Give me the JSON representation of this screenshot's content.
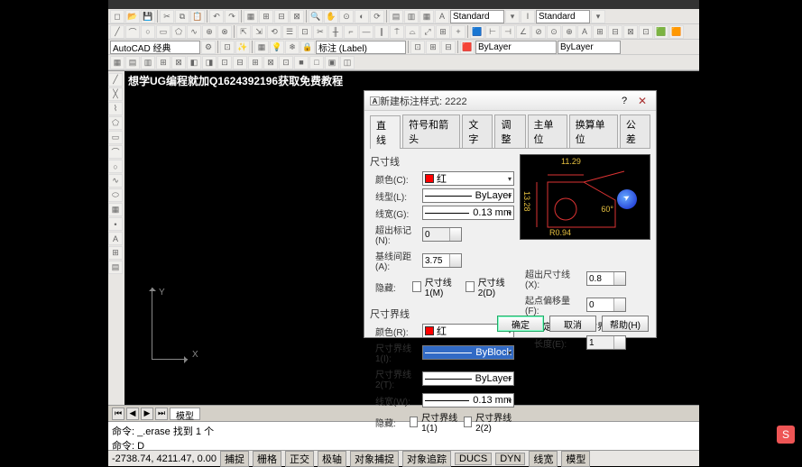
{
  "app": {
    "watermark": "想学UG编程就加Q1624392196获取免费教程",
    "toolbar": {
      "workspace_combo": "AutoCAD 经典",
      "annotation_combo": "标注 (Label)",
      "layer_combo": "ByLayer",
      "layer_combo2": "ByLayer",
      "std_combo1": "Standard",
      "std_combo2": "Standard"
    },
    "axis": {
      "x": "X",
      "y": "Y"
    },
    "bottom_tabs": {
      "model": "模型"
    },
    "cmd": {
      "line1": "命令: _.erase 找到 1 个",
      "line2": "命令: D"
    },
    "status": {
      "coords": "-2738.74, 4211.47, 0.00",
      "btns": [
        "捕捉",
        "栅格",
        "正交",
        "极轴",
        "对象捕捉",
        "对象追踪",
        "DUCS",
        "DYN",
        "线宽",
        "模型"
      ]
    }
  },
  "dialog": {
    "title": "新建标注样式: 2222",
    "help_btn": "?",
    "close_btn": "✕",
    "tabs": [
      "直线",
      "符号和箭头",
      "文字",
      "调整",
      "主单位",
      "换算单位",
      "公差"
    ],
    "dim_line": {
      "title": "尺寸线",
      "color_lbl": "颜色(C):",
      "color_val": "红",
      "linetype_lbl": "线型(L):",
      "linetype_val": "ByLayer",
      "lineweight_lbl": "线宽(G):",
      "lineweight_val": "0.13 mm",
      "ext_beyond_lbl": "超出标记(N):",
      "ext_beyond_val": "0",
      "baseline_lbl": "基线间距(A):",
      "baseline_val": "3.75",
      "hide_lbl": "隐藏:",
      "hide1": "尺寸线 1(M)",
      "hide2": "尺寸线 2(D)"
    },
    "ext_line": {
      "title": "尺寸界线",
      "color_lbl": "颜色(R):",
      "color_val": "红",
      "ext1_lbl": "尺寸界线 1(I):",
      "ext1_val": "ByBlock",
      "ext2_lbl": "尺寸界线 2(T):",
      "ext2_val": "ByLayer",
      "lineweight_lbl": "线宽(W):",
      "lineweight_val": "0.13 mm",
      "hide_lbl": "隐藏:",
      "hide1": "尺寸界线 1(1)",
      "hide2": "尺寸界线 2(2)"
    },
    "right": {
      "ext_beyond_lbl": "超出尺寸线(X):",
      "ext_beyond_val": "0.8",
      "offset_lbl": "起点偏移量(F):",
      "offset_val": "0",
      "fixed_lbl": "固定长度的尺寸界线(O)",
      "length_lbl": "长度(E):",
      "length_val": "1"
    },
    "preview": {
      "top_dim": "11.29",
      "left_dim": "13.28",
      "bottom_dim": "R0.94",
      "angle_dim": "60°"
    },
    "btns": {
      "ok": "确定",
      "cancel": "取消",
      "help": "帮助(H)"
    }
  },
  "ime": "S"
}
